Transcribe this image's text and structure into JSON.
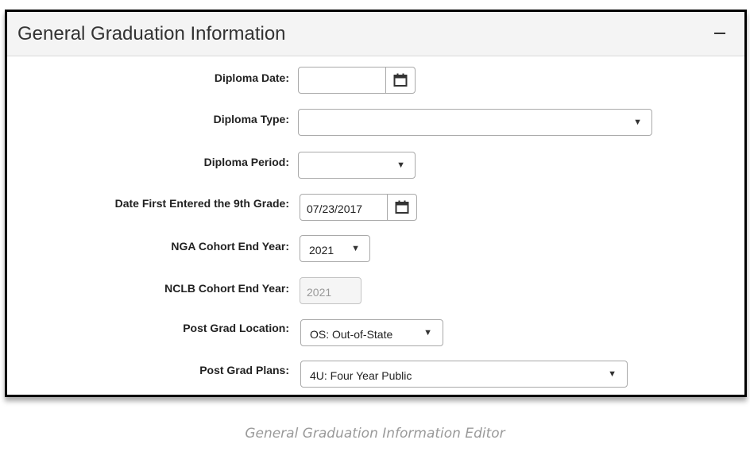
{
  "panel": {
    "title": "General Graduation Information",
    "collapse_icon": "minus-icon"
  },
  "fields": {
    "diploma_date": {
      "label": "Diploma Date:",
      "value": ""
    },
    "diploma_type": {
      "label": "Diploma Type:",
      "value": ""
    },
    "diploma_period": {
      "label": "Diploma Period:",
      "value": ""
    },
    "date_first_9th": {
      "label": "Date First Entered the 9th Grade:",
      "value": "07/23/2017"
    },
    "nga_cohort": {
      "label": "NGA Cohort End Year:",
      "value": "2021"
    },
    "nclb_cohort": {
      "label": "NCLB Cohort End Year:",
      "value": "2021"
    },
    "post_grad_location": {
      "label": "Post Grad Location:",
      "value": "OS: Out-of-State"
    },
    "post_grad_plans": {
      "label": "Post Grad Plans:",
      "value": "4U: Four Year Public"
    }
  },
  "icons": {
    "calendar": "calendar-icon",
    "dropdown": "▼"
  },
  "caption": "General Graduation Information Editor"
}
